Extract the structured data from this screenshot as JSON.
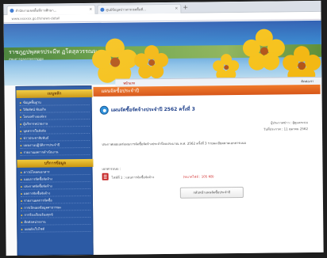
{
  "colors": {
    "banner_blue": "#3b8bd1",
    "banner_green": "#6fa64a",
    "flower_yellow": "#f6c21c",
    "sidebar_blue": "#2c5aa4",
    "sidebar_header_gold": "#e0b02b",
    "content_header_orange": "#f07a2a",
    "title_blue": "#1d3f8a",
    "size_red": "#d12b2b"
  },
  "browser": {
    "tabs": [
      {
        "label": "สำนักงานเขตพื้นที่การศึกษา...",
        "icon": "site-favicon"
      },
      {
        "label": "ศูนย์ข้อมูลข่าวสารเขตพื้นที่...",
        "icon": "site-favicon"
      }
    ],
    "new_tab_label": "+",
    "url": "www.xxxxxx.go.th/news-detail"
  },
  "banner": {
    "title": "ราชภูฏปพุสตรประมีท ฏโดสุลวรรณม",
    "subtitle": "สพมสารภูคครรพรรรฏฏย"
  },
  "nav": {
    "home_label": "หน้าแรก",
    "right_text": "ติดต่อเรา"
  },
  "sidebar": {
    "section1_label": "เมนูหลัก",
    "section1_items": [
      "ข้อมูลพื้นฐาน",
      "วิสัยทัศน์ พันธกิจ",
      "โครงสร้างองค์กร",
      "ผู้บริหารหน่วยงาน",
      "บุคลากรในสังกัด",
      "ข่าวประชาสัมพันธ์",
      "แผนงานปฏิบัติการประจำปี",
      "รายงานผลการดำเนินงาน"
    ],
    "section2_label": "บริการข้อมูล",
    "section2_items": [
      "ดาวน์โหลดเอกสาร",
      "แผนการจัดซื้อจัดจ้าง",
      "ประกาศจัดซื้อจัดจ้าง",
      "ผลการจัดซื้อจัดจ้าง",
      "รายงานผลการจัดซื้อ",
      "การเปิดเผยข้อมูลสาธารณะ",
      "การร้องเรียนร้องทุกข์",
      "ติดต่อหน่วยงาน",
      "แผนผังเว็บไซต์"
    ]
  },
  "content": {
    "section_header": "แผนจัดซื้อประจำปี",
    "post_title": "แผนจัดซื้อจัดจ้างประจำปี 2562 ครั้งที่ 3",
    "posted_by": "ผู้ประกาศข่าว : ผู้ดูแลระบบ",
    "posted_date": "วันที่ประกาศ : 11 ตุลาคม 2562",
    "body": "ประกาศเผยแพร่แผนการจัดซื้อจัดจ้างประจำปีงบประมาณ พ.ศ. 2562 ครั้งที่ 3 รายละเอียดตามเอกสารแนบ",
    "attachments_label": "เอกสารแนบ :",
    "attachment_name": "ไฟล์ที่ 1 : แผนการจัดซื้อจัดจ้าง",
    "attachment_size": "(ขนาดไฟล์ : 105 KB)",
    "back_button": "กลับหน้าแผนจัดซื้อประจำปี"
  }
}
